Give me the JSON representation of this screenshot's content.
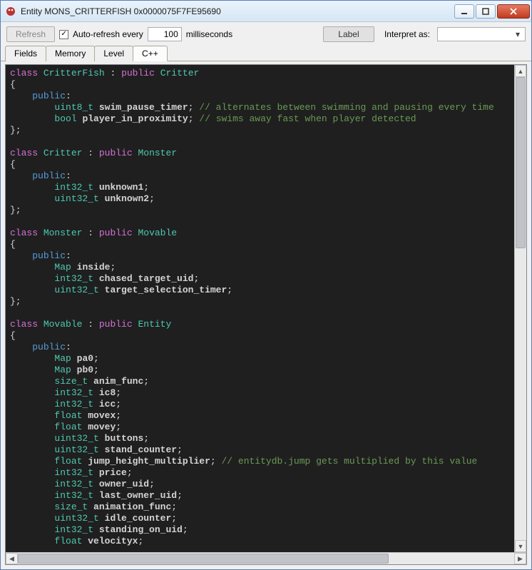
{
  "window": {
    "title": "Entity MONS_CRITTERFISH 0x0000075F7FE95690"
  },
  "toolbar": {
    "refresh_label": "Refresh",
    "auto_refresh_label": "Auto-refresh every",
    "interval": "100",
    "interval_unit": "milliseconds",
    "label_button": "Label",
    "interpret_label": "Interpret as:"
  },
  "tabs": {
    "fields": "Fields",
    "memory": "Memory",
    "level": "Level",
    "cpp": "C++"
  },
  "code": {
    "classes": [
      {
        "name": "CritterFish",
        "base": "Critter",
        "members": [
          {
            "type": "uint8_t",
            "name": "swim_pause_timer",
            "comment": "// alternates between swimming and pausing every time"
          },
          {
            "type": "bool",
            "name": "player_in_proximity",
            "comment": "// swims away fast when player detected"
          }
        ]
      },
      {
        "name": "Critter",
        "base": "Monster",
        "members": [
          {
            "type": "int32_t",
            "name": "unknown1"
          },
          {
            "type": "uint32_t",
            "name": "unknown2"
          }
        ]
      },
      {
        "name": "Monster",
        "base": "Movable",
        "members": [
          {
            "type": "Map",
            "name": "inside"
          },
          {
            "type": "int32_t",
            "name": "chased_target_uid"
          },
          {
            "type": "uint32_t",
            "name": "target_selection_timer"
          }
        ]
      },
      {
        "name": "Movable",
        "base": "Entity",
        "members": [
          {
            "type": "Map",
            "name": "pa0"
          },
          {
            "type": "Map",
            "name": "pb0"
          },
          {
            "type": "size_t",
            "name": "anim_func"
          },
          {
            "type": "int32_t",
            "name": "ic8"
          },
          {
            "type": "int32_t",
            "name": "icc"
          },
          {
            "type": "float",
            "name": "movex"
          },
          {
            "type": "float",
            "name": "movey"
          },
          {
            "type": "uint32_t",
            "name": "buttons"
          },
          {
            "type": "uint32_t",
            "name": "stand_counter"
          },
          {
            "type": "float",
            "name": "jump_height_multiplier",
            "comment": "// entitydb.jump gets multiplied by this value"
          },
          {
            "type": "int32_t",
            "name": "price"
          },
          {
            "type": "int32_t",
            "name": "owner_uid"
          },
          {
            "type": "int32_t",
            "name": "last_owner_uid"
          },
          {
            "type": "size_t",
            "name": "animation_func"
          },
          {
            "type": "uint32_t",
            "name": "idle_counter"
          },
          {
            "type": "int32_t",
            "name": "standing_on_uid"
          },
          {
            "type": "float",
            "name": "velocityx"
          }
        ]
      }
    ]
  }
}
